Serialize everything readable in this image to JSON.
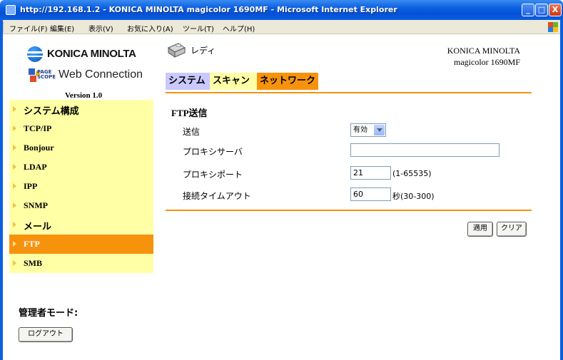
{
  "window": {
    "title": "http://192.168.1.2 - KONICA MINOLTA magicolor 1690MF - Microsoft Internet Explorer",
    "minimize": "_",
    "maximize": "□",
    "close": "X"
  },
  "menubar": {
    "items": [
      "ファイル(F)",
      "編集(E)",
      "表示(V)",
      "お気に入り(A)",
      "ツール(T)",
      "ヘルプ(H)"
    ]
  },
  "brand": {
    "logo_text": "KONICA MINOLTA",
    "pagescope_small": "PAGE SCOPE",
    "pagescope_text": "Web Connection",
    "version": "Version 1.0"
  },
  "nav": {
    "items": [
      {
        "label": "システム構成",
        "active": false
      },
      {
        "label": "TCP/IP",
        "active": false
      },
      {
        "label": "Bonjour",
        "active": false
      },
      {
        "label": "LDAP",
        "active": false
      },
      {
        "label": "IPP",
        "active": false
      },
      {
        "label": "SNMP",
        "active": false
      },
      {
        "label": "メール",
        "active": false
      },
      {
        "label": "FTP",
        "active": true
      },
      {
        "label": "SMB",
        "active": false
      }
    ]
  },
  "admin": {
    "label": "管理者モード:",
    "logout_button": "ログアウト"
  },
  "header": {
    "status": "レディ",
    "model_line1": "KONICA MINOLTA",
    "model_line2": "magicolor 1690MF"
  },
  "tabs": [
    "システム",
    "スキャン",
    "ネットワーク"
  ],
  "form": {
    "title": "FTP送信",
    "send_label": "送信",
    "send_value": "有効",
    "proxy_server_label": "プロキシサーバ",
    "proxy_server_value": "",
    "proxy_port_label": "プロキシポート",
    "proxy_port_value": "21",
    "proxy_port_hint": "(1-65535)",
    "timeout_label": "接続タイムアウト",
    "timeout_value": "60",
    "timeout_hint": "秒(30-300)"
  },
  "buttons": {
    "apply": "適用",
    "clear": "クリア"
  },
  "colors": {
    "accent_orange": "#f7920d",
    "nav_yellow": "#ffffa6",
    "tab_system": "#c9c9ff",
    "xp_titlebar": "#0b5fe0"
  }
}
